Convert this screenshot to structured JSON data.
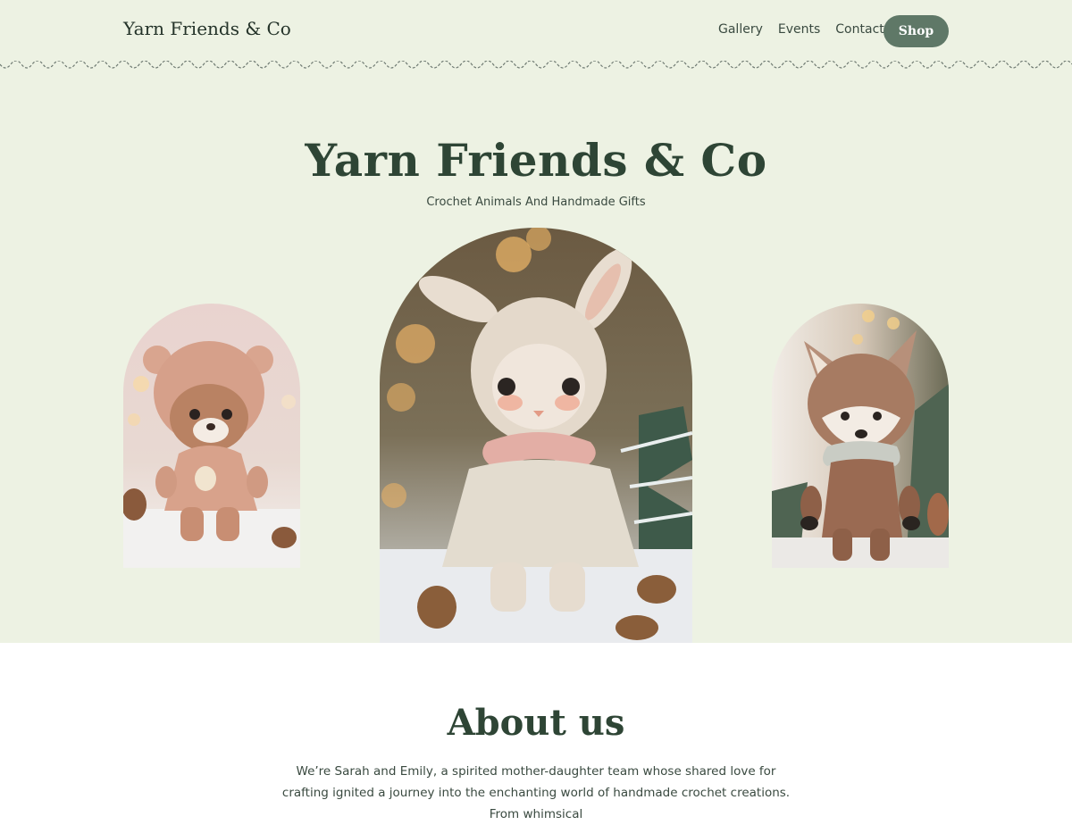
{
  "header": {
    "site_title": "Yarn Friends & Co",
    "nav": [
      "Gallery",
      "Events",
      "Contact"
    ],
    "shop_label": "Shop"
  },
  "hero": {
    "title": "Yarn Friends & Co",
    "subtitle": "Crochet Animals And Handmade Gifts",
    "images": [
      {
        "subject": "crochet-bear",
        "position": "left"
      },
      {
        "subject": "crochet-bunny",
        "position": "center"
      },
      {
        "subject": "crochet-fox",
        "position": "right"
      }
    ]
  },
  "about": {
    "title": "About us",
    "text": "We’re Sarah and Emily, a spirited mother-daughter team whose shared love for crafting ignited a journey into the enchanting world of handmade crochet creations. From whimsical"
  },
  "colors": {
    "hero_background": "#edf2e3",
    "accent": "#5f7867",
    "heading": "#2e4535"
  }
}
